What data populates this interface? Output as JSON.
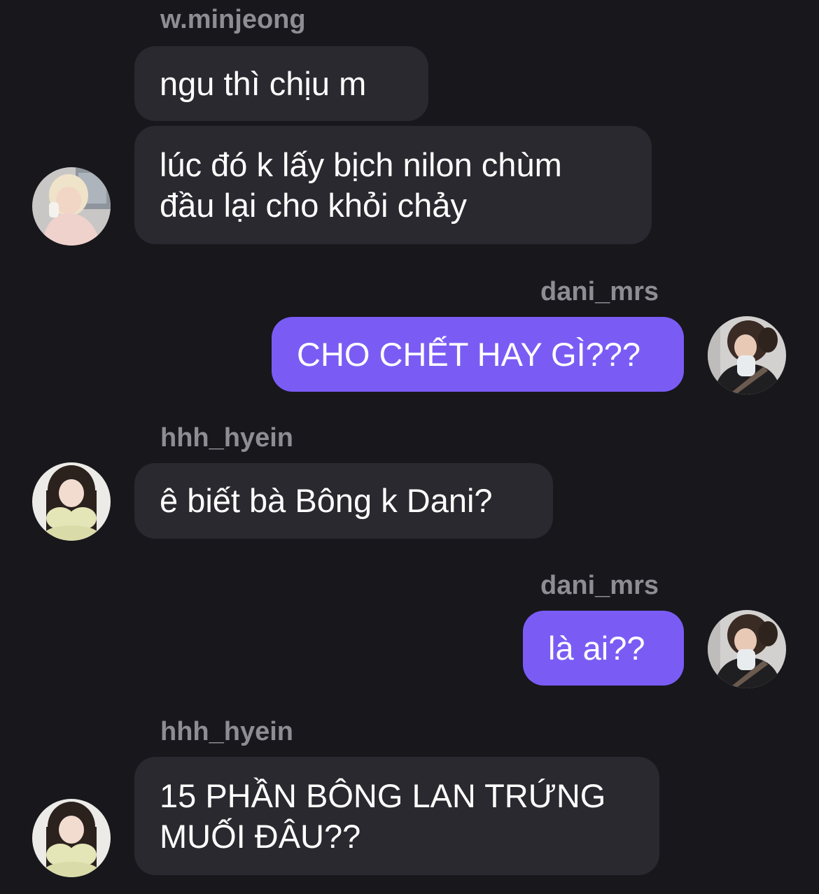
{
  "messages": [
    {
      "sender": "w.minjeong",
      "text": "ngu thì chịu m",
      "side": "in"
    },
    {
      "sender": "w.minjeong",
      "text": "lúc đó k lấy bịch nilon chùm\nđầu lại cho khỏi chảy",
      "side": "in",
      "avatar": "woman-blonde-avatar"
    },
    {
      "sender": "dani_mrs",
      "text": "CHO CHẾT HAY GÌ???",
      "side": "out",
      "avatar": "woman-dark-hair-avatar"
    },
    {
      "sender": "hhh_hyein",
      "text": "ê biết bà Bông k Dani?",
      "side": "in",
      "avatar": "girl-with-pillow-avatar"
    },
    {
      "sender": "dani_mrs",
      "text": "là ai??",
      "side": "out",
      "avatar": "woman-dark-hair-avatar"
    },
    {
      "sender": "hhh_hyein",
      "text": "15 PHẦN BÔNG LAN TRỨNG\nMUỐI ĐÂU??",
      "side": "in",
      "avatar": "girl-with-pillow-avatar"
    }
  ],
  "colors": {
    "background": "#18171c",
    "incoming_bubble": "#2a292f",
    "outgoing_bubble": "#7a5cf5",
    "sender_name": "#8e8d93",
    "message_text": "#ffffff"
  }
}
